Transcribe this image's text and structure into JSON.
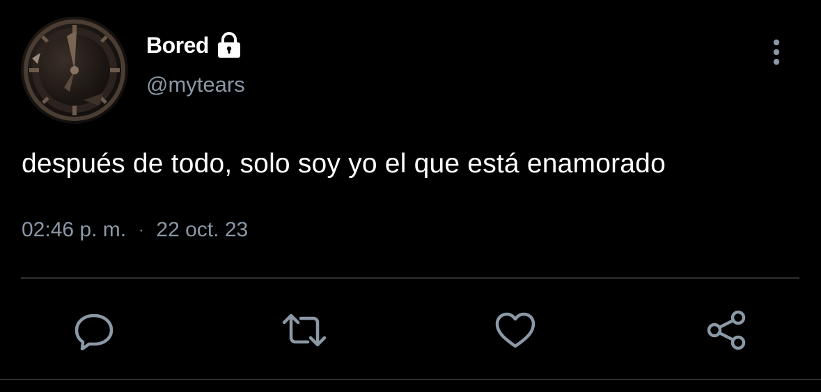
{
  "author": {
    "display_name": "Bored",
    "handle": "@mytears",
    "avatar_icon": "clock-avatar-image",
    "protected_icon": "lock-icon"
  },
  "tweet": {
    "text": "después de todo, solo soy yo el que está enamorado",
    "time": "02:46 p. m.",
    "separator": "·",
    "date": "22 oct. 23"
  },
  "actions": {
    "reply_icon": "reply-icon",
    "retweet_icon": "retweet-icon",
    "like_icon": "heart-icon",
    "share_icon": "share-icon",
    "more_icon": "more-vertical-icon"
  },
  "colors": {
    "background": "#000000",
    "primary_text": "#ffffff",
    "secondary_text": "#8b98a5",
    "divider": "#2f3336"
  }
}
